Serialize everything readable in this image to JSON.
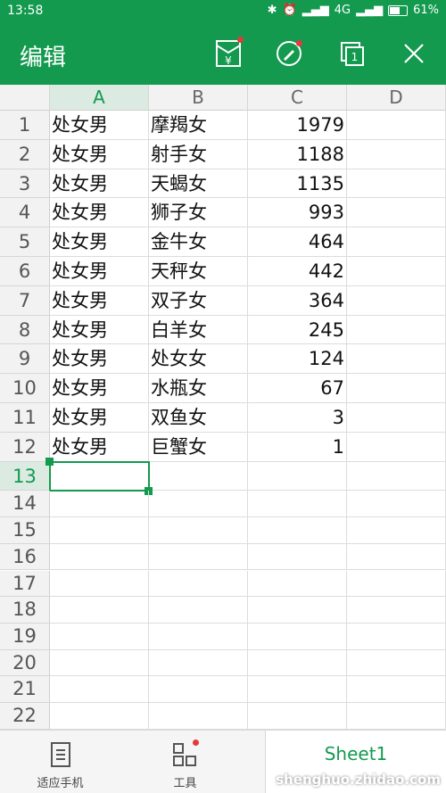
{
  "status_bar": {
    "time": "13:58",
    "network": "4G",
    "battery": "61%"
  },
  "app_bar": {
    "title": "编辑"
  },
  "columns": [
    "A",
    "B",
    "C",
    "D"
  ],
  "selected_column": "A",
  "selected_row": 13,
  "rows": [
    {
      "n": "1",
      "a": "处女男",
      "b": "摩羯女",
      "c": "1979"
    },
    {
      "n": "2",
      "a": "处女男",
      "b": "射手女",
      "c": "1188"
    },
    {
      "n": "3",
      "a": "处女男",
      "b": "天蝎女",
      "c": "1135"
    },
    {
      "n": "4",
      "a": "处女男",
      "b": "狮子女",
      "c": "993"
    },
    {
      "n": "5",
      "a": "处女男",
      "b": "金牛女",
      "c": "464"
    },
    {
      "n": "6",
      "a": "处女男",
      "b": "天秤女",
      "c": "442"
    },
    {
      "n": "7",
      "a": "处女男",
      "b": "双子女",
      "c": "364"
    },
    {
      "n": "8",
      "a": "处女男",
      "b": "白羊女",
      "c": "245"
    },
    {
      "n": "9",
      "a": "处女男",
      "b": "处女女",
      "c": "124"
    },
    {
      "n": "10",
      "a": "处女男",
      "b": "水瓶女",
      "c": "67"
    },
    {
      "n": "11",
      "a": "处女男",
      "b": "双鱼女",
      "c": "3"
    },
    {
      "n": "12",
      "a": "处女男",
      "b": "巨蟹女",
      "c": "1"
    },
    {
      "n": "13",
      "a": "",
      "b": "",
      "c": ""
    },
    {
      "n": "14",
      "a": "",
      "b": "",
      "c": ""
    },
    {
      "n": "15",
      "a": "",
      "b": "",
      "c": ""
    },
    {
      "n": "16",
      "a": "",
      "b": "",
      "c": ""
    },
    {
      "n": "17",
      "a": "",
      "b": "",
      "c": ""
    },
    {
      "n": "18",
      "a": "",
      "b": "",
      "c": ""
    },
    {
      "n": "19",
      "a": "",
      "b": "",
      "c": ""
    },
    {
      "n": "20",
      "a": "",
      "b": "",
      "c": ""
    },
    {
      "n": "21",
      "a": "",
      "b": "",
      "c": ""
    },
    {
      "n": "22",
      "a": "",
      "b": "",
      "c": ""
    }
  ],
  "bottom_bar": {
    "fit_phone_label": "适应手机",
    "tools_label": "工具",
    "sheet_name": "Sheet1"
  },
  "watermark": "shenghuo.zhidao.com",
  "colors": {
    "accent": "#139a4f",
    "badge": "#e5393a"
  }
}
